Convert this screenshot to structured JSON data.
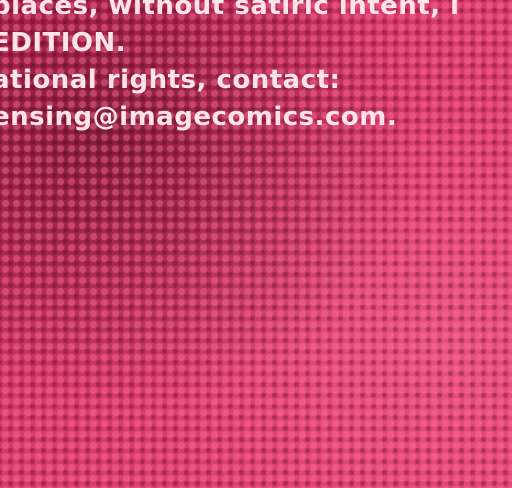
{
  "document": {
    "lines": [
      "places, without satiric intent, i",
      "EDITION.",
      "ational rights, contact:",
      "ensing@imagecomics.com."
    ]
  }
}
